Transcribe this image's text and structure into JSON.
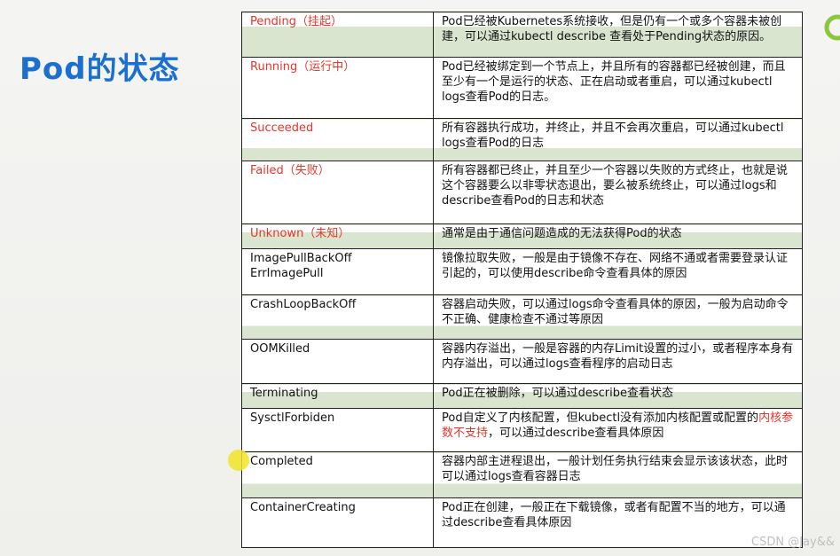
{
  "slide": {
    "title": "Pod的状态"
  },
  "table": {
    "rows": [
      {
        "name": "Pending（挂起）",
        "name_color": "red",
        "desc": "Pod已经被Kubernetes系统接收，但是仍有一个或多个容器未被创建，可以通过kubectl describe 查看处于Pending状态的原因。"
      },
      {
        "name": "Running（运行中）",
        "name_color": "red",
        "desc": "Pod已经被绑定到一个节点上，并且所有的容器都已经被创建，而且至少有一个是运行的状态、正在启动或者重启，可以通过kubectl logs查看Pod的日志。"
      },
      {
        "name": "Succeeded",
        "name_color": "red",
        "desc": "所有容器执行成功，并终止，并且不会再次重启，可以通过kubectl logs查看Pod的日志"
      },
      {
        "name": "Failed（失败）",
        "name_color": "red",
        "desc": "所有容器都已终止，并且至少一个容器以失败的方式终止，也就是说这个容器要么以非零状态退出，要么被系统终止，可以通过logs和describe查看Pod的日志和状态"
      },
      {
        "name": "Unknown（未知）",
        "name_color": "red",
        "desc": "通常是由于通信问题造成的无法获得Pod的状态"
      },
      {
        "name": "ImagePullBackOff ErrImagePull",
        "name_color": "black",
        "desc": "镜像拉取失败，一般是由于镜像不存在、网络不通或者需要登录认证引起的，可以使用describe命令查看具体的原因"
      },
      {
        "name": "CrashLoopBackOff",
        "name_color": "black",
        "desc": "容器启动失败，可以通过logs命令查看具体的原因，一般为启动命令不正确、健康检查不通过等原因"
      },
      {
        "name": "OOMKilled",
        "name_color": "black",
        "desc": "容器内存溢出，一般是容器的内存Limit设置的过小，或者程序本身有内存溢出，可以通过logs查看程序的启动日志"
      },
      {
        "name": "Terminating",
        "name_color": "black",
        "desc": "Pod正在被删除，可以通过describe查看状态"
      },
      {
        "name": "SysctlForbiden",
        "name_color": "black",
        "desc_before": "Pod自定义了内核配置，但kubectl没有添加内核配置或配置的",
        "desc_highlight": "内核参数不支持",
        "desc_after": "，可以通过describe查看具体原因"
      },
      {
        "name": "Completed",
        "name_color": "black",
        "desc": "容器内部主进程退出，一般计划任务执行结束会显示该该状态，此时可以通过logs查看容器日志"
      },
      {
        "name": "ContainerCreating",
        "name_color": "black",
        "desc": "Pod正在创建，一般正在下载镜像，或者有配置不当的地方，可以通过describe查看具体原因"
      }
    ]
  },
  "watermark": "CSDN @Jay&&",
  "colors": {
    "title": "#1a6fd0",
    "status_red": "#e8352a",
    "row_band": "#d9e5cf",
    "logo": "#8cc63f"
  },
  "icons": {
    "logo": "ring-logo-icon",
    "cursor": "cursor-highlight-icon"
  }
}
